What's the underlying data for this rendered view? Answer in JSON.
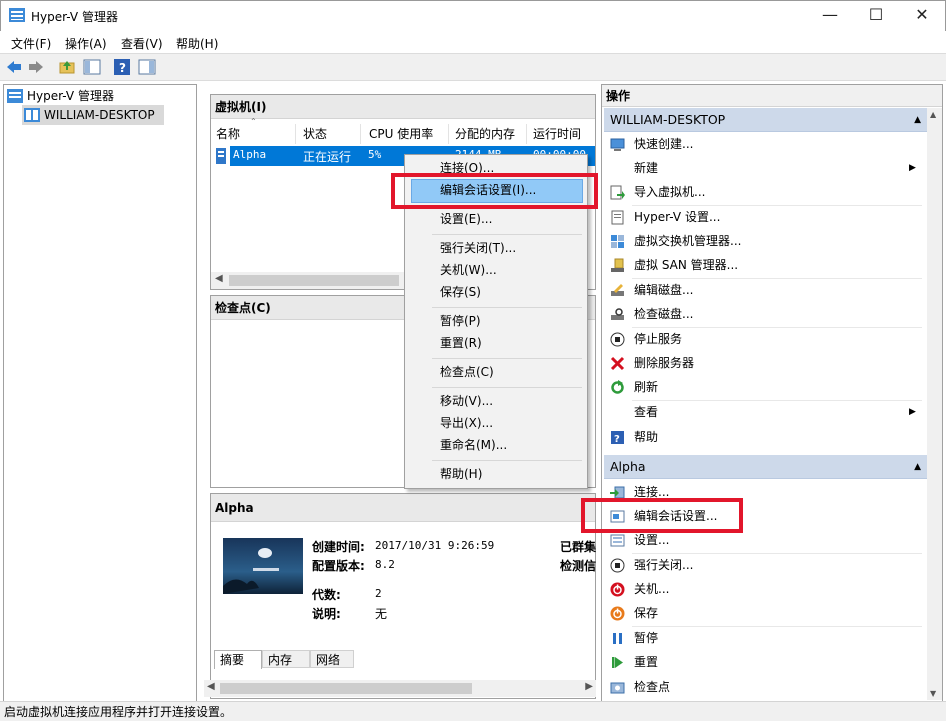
{
  "window": {
    "title": "Hyper-V 管理器"
  },
  "menubar": [
    "文件(F)",
    "操作(A)",
    "查看(V)",
    "帮助(H)"
  ],
  "tree": {
    "root": "Hyper-V 管理器",
    "child": "WILLIAM-DESKTOP"
  },
  "vm_panel": {
    "title": "虚拟机(I)",
    "columns": [
      "名称",
      "状态",
      "CPU 使用率",
      "分配的内存",
      "运行时间"
    ],
    "row": {
      "name": "Alpha",
      "state": "正在运行",
      "cpu": "5%",
      "memory": "2144 MB",
      "uptime": "00:00:00"
    }
  },
  "checkpoint_panel": {
    "title": "检查点(C)"
  },
  "context_menu": {
    "items": [
      "连接(O)...",
      "编辑会话设置(I)...",
      "设置(E)...",
      "强行关闭(T)...",
      "关机(W)...",
      "保存(S)",
      "暂停(P)",
      "重置(R)",
      "检查点(C)",
      "移动(V)...",
      "导出(X)...",
      "重命名(M)...",
      "帮助(H)"
    ],
    "highlighted": "编辑会话设置(I)..."
  },
  "details": {
    "title": "Alpha",
    "created_label": "创建时间:",
    "created": "2017/10/31 9:26:59",
    "version_label": "配置版本:",
    "version": "8.2",
    "gen_label": "代数:",
    "gen": "2",
    "notes_label": "说明:",
    "notes": "无",
    "right1": "已群集",
    "right2": "检测信",
    "tabs": [
      "摘要",
      "内存",
      "网络"
    ]
  },
  "actions": {
    "title": "操作",
    "host_section": "WILLIAM-DESKTOP",
    "host_items": [
      "快速创建...",
      "新建",
      "导入虚拟机...",
      "Hyper-V 设置...",
      "虚拟交换机管理器...",
      "虚拟 SAN 管理器...",
      "编辑磁盘...",
      "检查磁盘...",
      "停止服务",
      "删除服务器",
      "刷新",
      "查看",
      "帮助"
    ],
    "vm_section": "Alpha",
    "vm_items": [
      "连接...",
      "编辑会话设置...",
      "设置...",
      "强行关闭...",
      "关机...",
      "保存",
      "暂停",
      "重置",
      "检查点"
    ]
  },
  "statusbar": {
    "text": "启动虚拟机连接应用程序并打开连接设置。"
  },
  "colors": {
    "selection": "#0078d7",
    "highlight_box": "#e2162b",
    "section_header": "#cdd9ea"
  }
}
